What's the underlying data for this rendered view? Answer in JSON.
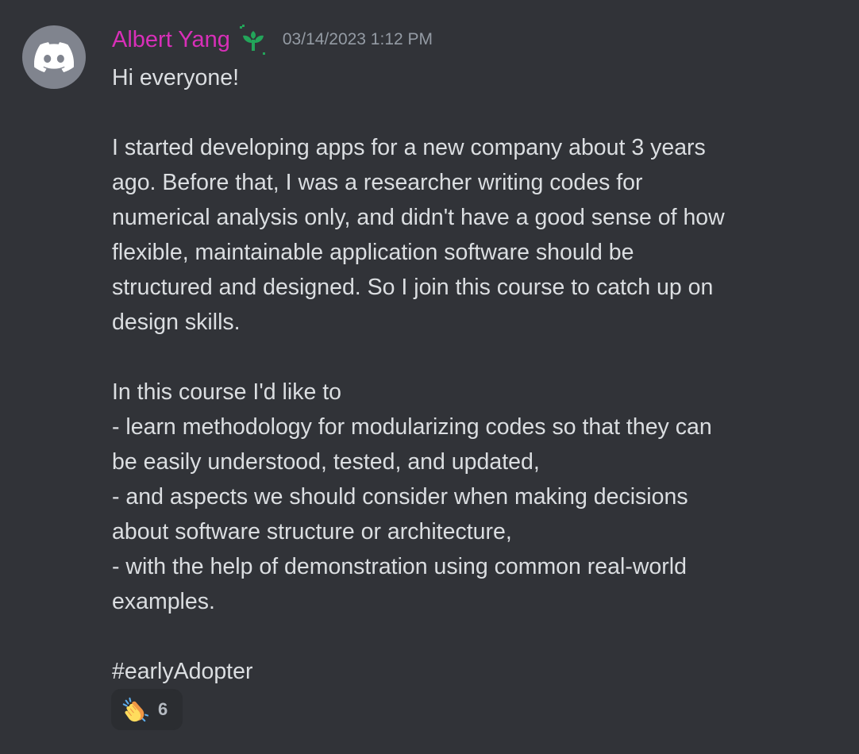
{
  "message": {
    "author": "Albert Yang",
    "author_color": "#d82fb8",
    "role_icon": "sprout-icon",
    "timestamp": "03/14/2023 1:12 PM",
    "avatar_icon": "discord-logo-icon",
    "lines": [
      "Hi everyone!",
      "",
      "I started developing apps for a new company about 3 years",
      "ago. Before that, I was a researcher writing codes for",
      "numerical analysis only, and didn't have a good sense of how",
      "flexible, maintainable application software should be",
      "structured and designed. So I join this course to catch up on",
      "design skills.",
      "",
      "In this course I'd like to",
      "- learn methodology for modularizing codes so that they can",
      "be easily understood, tested, and updated,",
      "- and aspects we should consider when making decisions",
      "about software structure or architecture,",
      "- with the help of demonstration using common real-world",
      "examples.",
      "",
      "#earlyAdopter"
    ]
  },
  "reaction": {
    "emoji": "clapping-hands-icon",
    "count": "6"
  },
  "colors": {
    "background": "#313338",
    "text": "#dbdee1",
    "timestamp": "#949ba4",
    "role_icon": "#23a55a",
    "reaction_bg": "#2b2d31"
  }
}
